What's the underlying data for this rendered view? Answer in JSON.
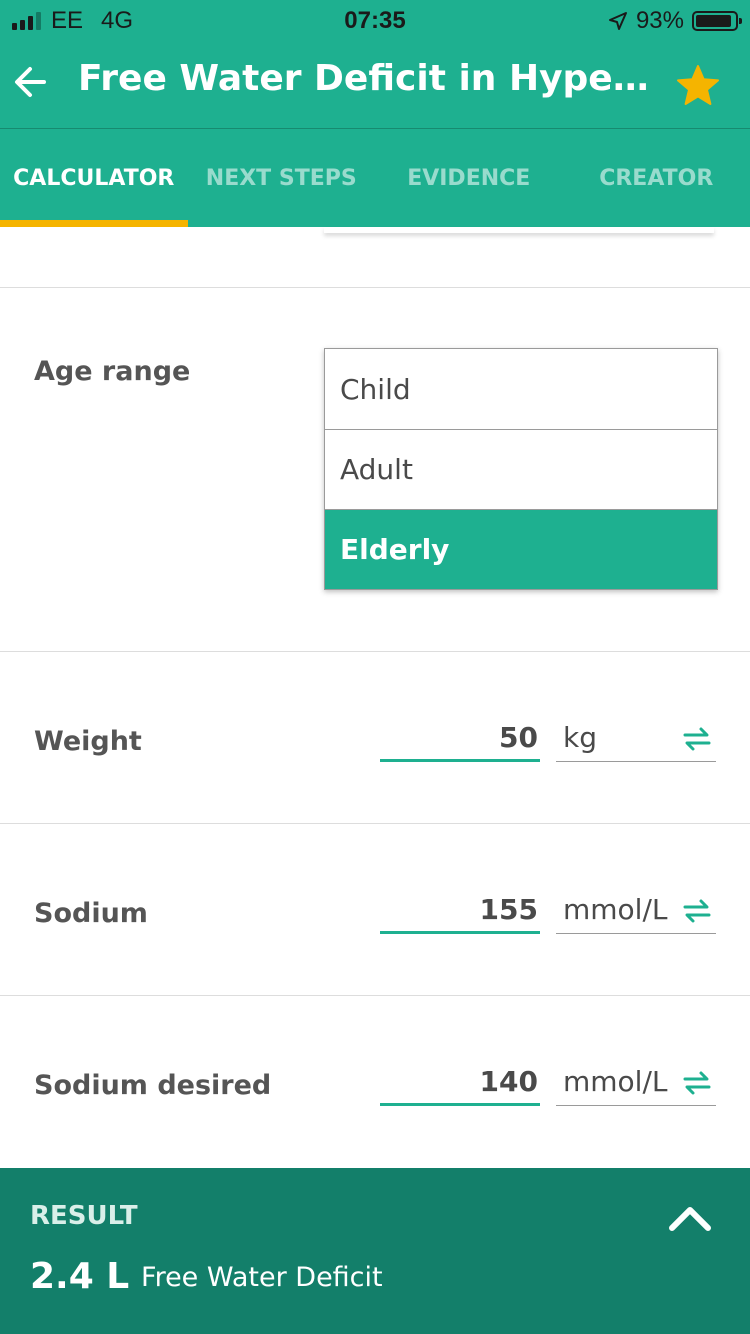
{
  "status_bar": {
    "carrier": "EE",
    "network": "4G",
    "time": "07:35",
    "battery_text": "93%",
    "battery_level": 0.93,
    "signal_bars": 3
  },
  "app_bar": {
    "back_icon": "arrow-left-icon",
    "title": "Free Water Deficit in Hypernatremia",
    "favorite_icon": "star-icon"
  },
  "tabs": [
    {
      "label": "CALCULATOR",
      "active": true
    },
    {
      "label": "NEXT STEPS",
      "active": false
    },
    {
      "label": "EVIDENCE",
      "active": false
    },
    {
      "label": "CREATOR",
      "active": false
    }
  ],
  "form": {
    "age_range": {
      "label": "Age range",
      "options": [
        "Child",
        "Adult",
        "Elderly"
      ],
      "selected": "Elderly"
    },
    "weight": {
      "label": "Weight",
      "value": "50",
      "unit": "kg"
    },
    "sodium": {
      "label": "Sodium",
      "value": "155",
      "unit": "mmol/L"
    },
    "sodium_desired": {
      "label": "Sodium desired",
      "value": "140",
      "unit": "mmol/L"
    }
  },
  "result": {
    "label": "RESULT",
    "value": "2.4 L",
    "description": "Free Water Deficit",
    "toggle_icon": "chevron-up-icon"
  },
  "colors": {
    "primary": "#1eb090",
    "result_bar": "#137f6a",
    "tab_indicator": "#f5b400",
    "star": "#f5b400"
  }
}
